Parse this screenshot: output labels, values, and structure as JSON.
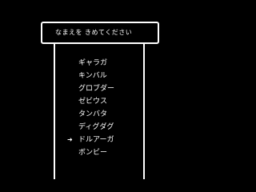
{
  "title_window": {
    "prompt": "なまえを きめてください"
  },
  "name_list": {
    "items": [
      "ギャラガ",
      "キンバル",
      "グロブダー",
      "ゼビウス",
      "タンバタ",
      "ディグダグ",
      "ドルアーガ",
      "ボンビー"
    ],
    "selected_index": 6
  },
  "icons": {
    "cursor": "right-arrow-cursor-icon",
    "cursor_glyph": "➜"
  },
  "colors": {
    "background": "#000000",
    "text": "#ffffff",
    "border": "#ffffff"
  }
}
